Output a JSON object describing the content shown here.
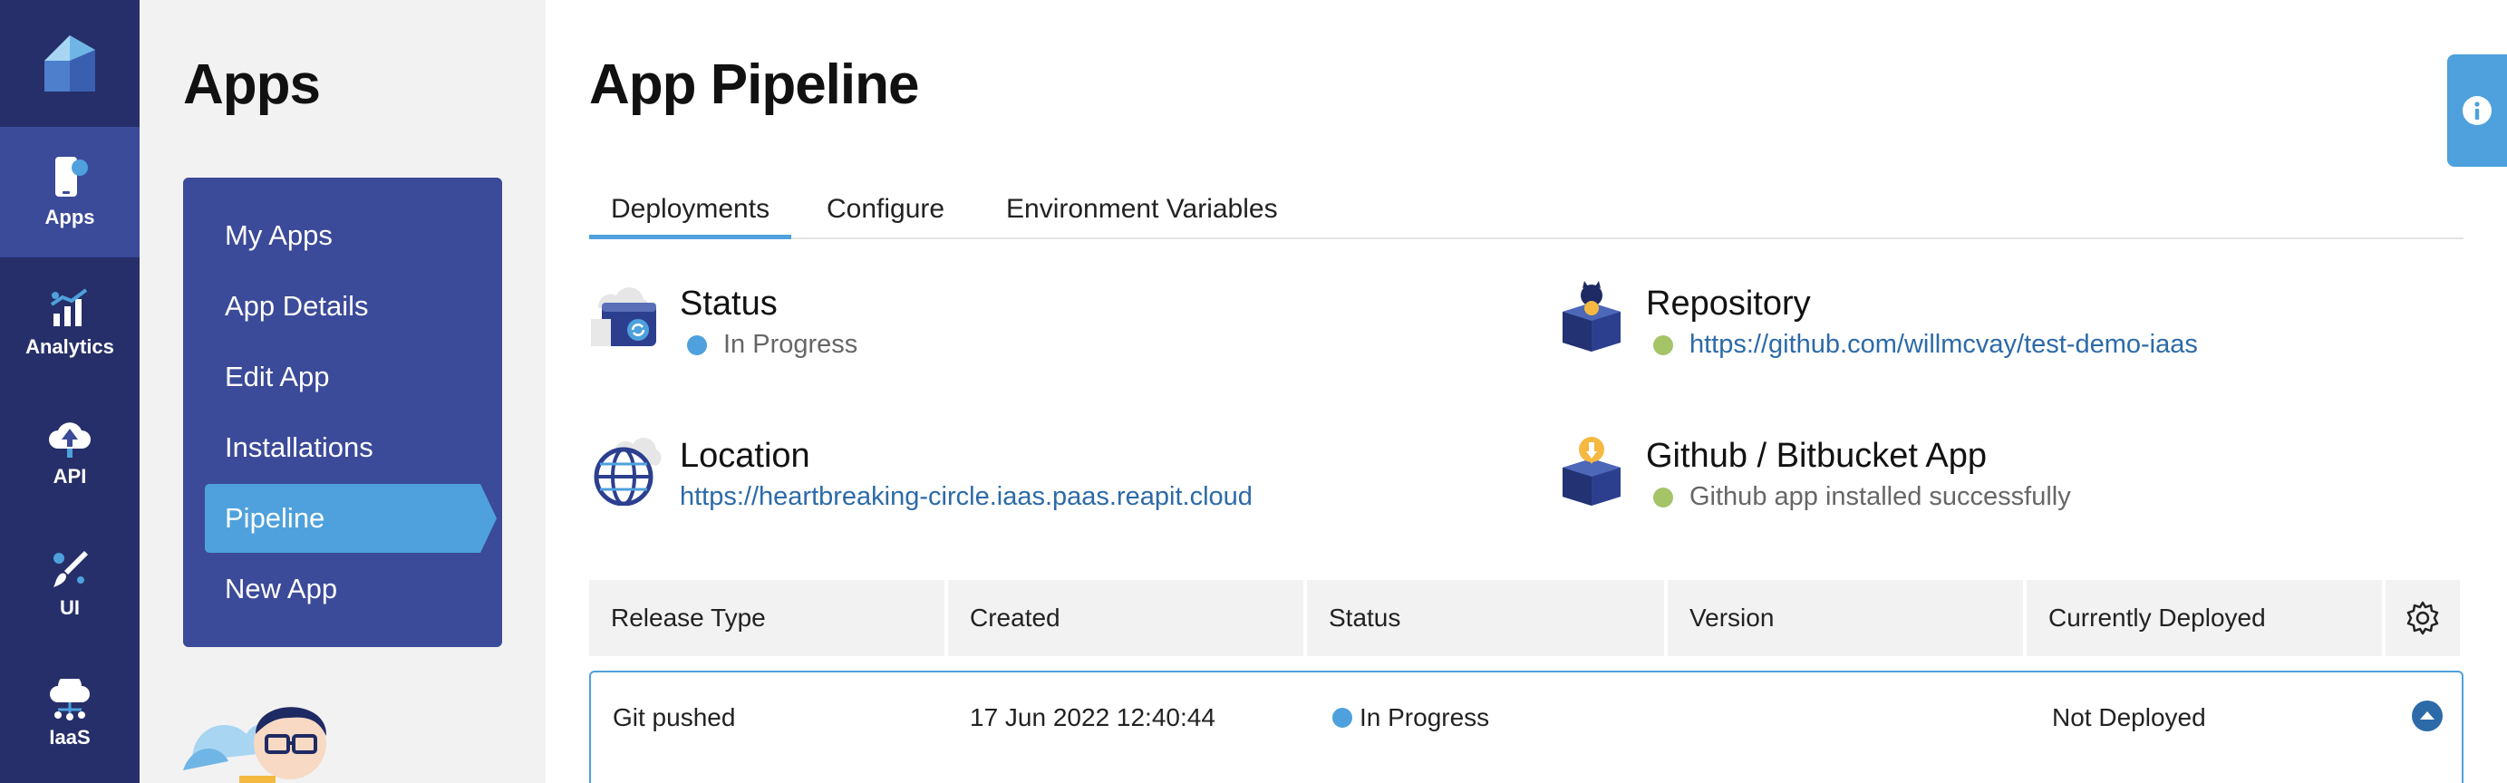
{
  "rail": {
    "items": [
      {
        "label": "Apps",
        "icon": "phone-app-icon"
      },
      {
        "label": "Analytics",
        "icon": "analytics-chart-icon"
      },
      {
        "label": "API",
        "icon": "cloud-upload-icon"
      },
      {
        "label": "UI",
        "icon": "paint-brush-icon"
      },
      {
        "label": "IaaS",
        "icon": "cloud-network-icon"
      }
    ]
  },
  "sidebar": {
    "title": "Apps",
    "items": [
      {
        "label": "My Apps"
      },
      {
        "label": "App Details"
      },
      {
        "label": "Edit App"
      },
      {
        "label": "Installations"
      },
      {
        "label": "Pipeline"
      },
      {
        "label": "New App"
      }
    ],
    "active": "Pipeline"
  },
  "main": {
    "title": "App Pipeline",
    "tabs": [
      {
        "label": "Deployments"
      },
      {
        "label": "Configure"
      },
      {
        "label": "Environment Variables"
      }
    ],
    "active_tab": "Deployments",
    "cards": {
      "status": {
        "title": "Status",
        "value": "In Progress"
      },
      "repository": {
        "title": "Repository",
        "value": "https://github.com/willmcvay/test-demo-iaas"
      },
      "location": {
        "title": "Location",
        "value": "https://heartbreaking-circle.iaas.paas.reapit.cloud"
      },
      "github": {
        "title": "Github / Bitbucket App",
        "value": "Github app installed successfully"
      }
    },
    "table": {
      "headers": [
        "Release Type",
        "Created",
        "Status",
        "Version",
        "Currently Deployed"
      ],
      "rows": [
        {
          "release_type": "Git pushed",
          "created": "17 Jun 2022 12:40:44",
          "status": "In Progress",
          "version": "",
          "deployed": "Not Deployed"
        }
      ]
    }
  },
  "colors": {
    "rail_bg": "#262f69",
    "menu_bg": "#3b4a99",
    "accent": "#4ea1dc",
    "link": "#2c6aa8",
    "success": "#a4c467"
  }
}
